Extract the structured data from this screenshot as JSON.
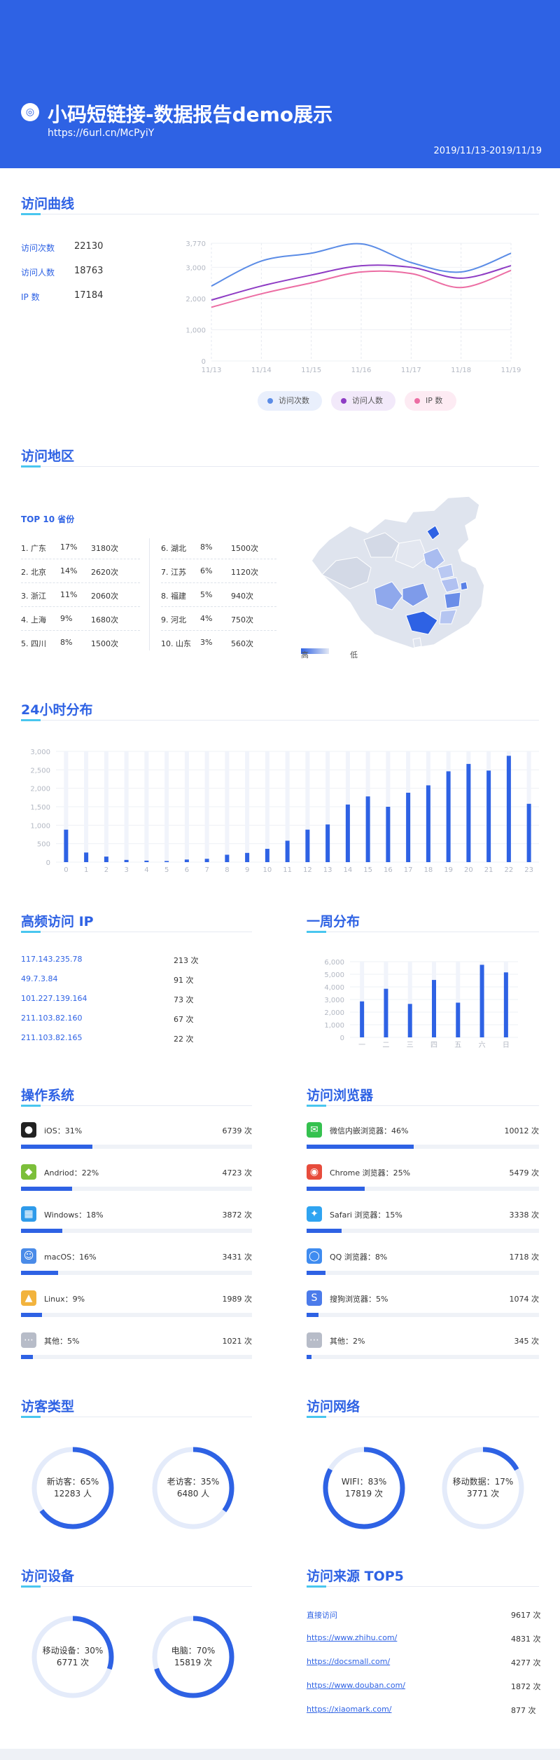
{
  "header": {
    "title": "小码短链接-数据报告demo展示",
    "url": "https://6url.cn/McPyiY",
    "date_range": "2019/11/13-2019/11/19"
  },
  "visits": {
    "title": "访问曲线",
    "stats": [
      {
        "label": "访问次数",
        "value": "22130"
      },
      {
        "label": "访问人数",
        "value": "18763"
      },
      {
        "label": "IP 数",
        "value": "17184"
      }
    ]
  },
  "region": {
    "title": "访问地区",
    "top10_title": "TOP 10 省份",
    "provinces": [
      {
        "rank": "1. 广东",
        "pct": "17%",
        "count": "3180次"
      },
      {
        "rank": "2. 北京",
        "pct": "14%",
        "count": "2620次"
      },
      {
        "rank": "3. 浙江",
        "pct": "11%",
        "count": "2060次"
      },
      {
        "rank": "4. 上海",
        "pct": "9%",
        "count": "1680次"
      },
      {
        "rank": "5. 四川",
        "pct": "8%",
        "count": "1500次"
      },
      {
        "rank": "6. 湖北",
        "pct": "8%",
        "count": "1500次"
      },
      {
        "rank": "7. 江苏",
        "pct": "6%",
        "count": "1120次"
      },
      {
        "rank": "8. 福建",
        "pct": "5%",
        "count": "940次"
      },
      {
        "rank": "9. 河北",
        "pct": "4%",
        "count": "750次"
      },
      {
        "rank": "10. 山东",
        "pct": "3%",
        "count": "560次"
      }
    ],
    "legend_high": "高",
    "legend_low": "低"
  },
  "hourly": {
    "title": "24小时分布"
  },
  "ip": {
    "title": "高频访问 IP",
    "rows": [
      {
        "addr": "117.143.235.78",
        "count": "213 次"
      },
      {
        "addr": "49.7.3.84",
        "count": "91 次"
      },
      {
        "addr": "101.227.139.164",
        "count": "73 次"
      },
      {
        "addr": "211.103.82.160",
        "count": "67 次"
      },
      {
        "addr": "211.103.82.165",
        "count": "22 次"
      }
    ]
  },
  "weekly": {
    "title": "一周分布"
  },
  "os": {
    "title": "操作系统",
    "rows": [
      {
        "icon": "apple-icon",
        "label": "iOS：31%",
        "count": "6739 次",
        "frac": 0.31
      },
      {
        "icon": "android-icon",
        "label": "Andriod：22%",
        "count": "4723 次",
        "frac": 0.22
      },
      {
        "icon": "windows-icon",
        "label": "Windows：18%",
        "count": "3872 次",
        "frac": 0.18
      },
      {
        "icon": "finder-icon",
        "label": "macOS：16%",
        "count": "3431 次",
        "frac": 0.16
      },
      {
        "icon": "linux-icon",
        "label": "Linux：9%",
        "count": "1989 次",
        "frac": 0.09
      },
      {
        "icon": "more-icon",
        "label": "其他：5%",
        "count": "1021 次",
        "frac": 0.05
      }
    ]
  },
  "browser": {
    "title": "访问浏览器",
    "rows": [
      {
        "icon": "wechat-icon",
        "label": "微信内嵌浏览器：46%",
        "count": "10012 次",
        "frac": 0.46
      },
      {
        "icon": "chrome-icon",
        "label": "Chrome 浏览器：25%",
        "count": "5479 次",
        "frac": 0.25
      },
      {
        "icon": "safari-icon",
        "label": "Safari 浏览器：15%",
        "count": "3338 次",
        "frac": 0.15
      },
      {
        "icon": "qq-browser-icon",
        "label": "QQ 浏览器：8%",
        "count": "1718 次",
        "frac": 0.08
      },
      {
        "icon": "sogou-icon",
        "label": "搜狗浏览器：5%",
        "count": "1074 次",
        "frac": 0.05
      },
      {
        "icon": "more-icon",
        "label": "其他：2%",
        "count": "345 次",
        "frac": 0.02
      }
    ]
  },
  "visitor_type": {
    "title": "访客类型",
    "rings": [
      {
        "line1": "新访客：65%",
        "line2": "12283 人",
        "frac": 0.65
      },
      {
        "line1": "老访客：35%",
        "line2": "6480 人",
        "frac": 0.35
      }
    ]
  },
  "network": {
    "title": "访问网络",
    "rings": [
      {
        "line1": "WIFI：83%",
        "line2": "17819 次",
        "frac": 0.83
      },
      {
        "line1": "移动数据：17%",
        "line2": "3771 次",
        "frac": 0.17
      }
    ]
  },
  "device": {
    "title": "访问设备",
    "rings": [
      {
        "line1": "移动设备：30%",
        "line2": "6771 次",
        "frac": 0.3
      },
      {
        "line1": "电脑：70%",
        "line2": "15819 次",
        "frac": 0.7
      }
    ]
  },
  "source": {
    "title": "访问来源 TOP5",
    "rows": [
      {
        "label": "直接访问",
        "count": "9617 次"
      },
      {
        "label": "https://www.zhihu.com/",
        "count": "4831 次"
      },
      {
        "label": "https://docsmall.com/",
        "count": "4277 次"
      },
      {
        "label": "https://www.douban.com/",
        "count": "1872 次"
      },
      {
        "label": "https://xiaomark.com/",
        "count": "877 次"
      }
    ]
  },
  "chart_data": [
    {
      "type": "line",
      "x": [
        "11/13",
        "11/14",
        "11/15",
        "11/16",
        "11/17",
        "11/18",
        "11/19"
      ],
      "ylim": [
        0,
        3770
      ],
      "yticks": [
        "0",
        "1,000",
        "2,000",
        "3,000",
        "3,770"
      ],
      "grid": true,
      "legend_position": "bottom",
      "series": [
        {
          "name": "访问次数",
          "color": "#5b8ce6",
          "values": [
            2400,
            3200,
            3450,
            3750,
            3150,
            2850,
            3450
          ]
        },
        {
          "name": "访问人数",
          "color": "#8e3cc4",
          "values": [
            1950,
            2400,
            2750,
            3050,
            3000,
            2650,
            3050
          ]
        },
        {
          "name": "IP 数",
          "color": "#ec6da3",
          "values": [
            1720,
            2150,
            2500,
            2850,
            2800,
            2350,
            2900
          ]
        }
      ]
    },
    {
      "type": "bar",
      "categories": [
        "0",
        "1",
        "2",
        "3",
        "4",
        "5",
        "6",
        "7",
        "8",
        "9",
        "10",
        "11",
        "12",
        "13",
        "14",
        "15",
        "16",
        "17",
        "18",
        "19",
        "20",
        "21",
        "22",
        "23"
      ],
      "values": [
        880,
        260,
        150,
        60,
        40,
        30,
        70,
        90,
        200,
        250,
        360,
        580,
        880,
        1020,
        1560,
        1780,
        1500,
        1880,
        2080,
        2460,
        2660,
        2480,
        2880,
        1580
      ],
      "ylim": [
        0,
        3000
      ],
      "yticks": [
        "0",
        "500",
        "1,000",
        "1,500",
        "2,000",
        "2,500",
        "3,000"
      ]
    },
    {
      "type": "bar",
      "categories": [
        "一",
        "二",
        "三",
        "四",
        "五",
        "六",
        "日"
      ],
      "values": [
        2850,
        3850,
        2650,
        4550,
        2750,
        5750,
        5150
      ],
      "ylim": [
        0,
        6000
      ],
      "yticks": [
        "0",
        "1,000",
        "2,000",
        "3,000",
        "4,000",
        "5,000",
        "6,000"
      ]
    }
  ],
  "colors": {
    "primary": "#2e62e4",
    "accent": "#49c6ef",
    "track": "#eff2f7"
  }
}
